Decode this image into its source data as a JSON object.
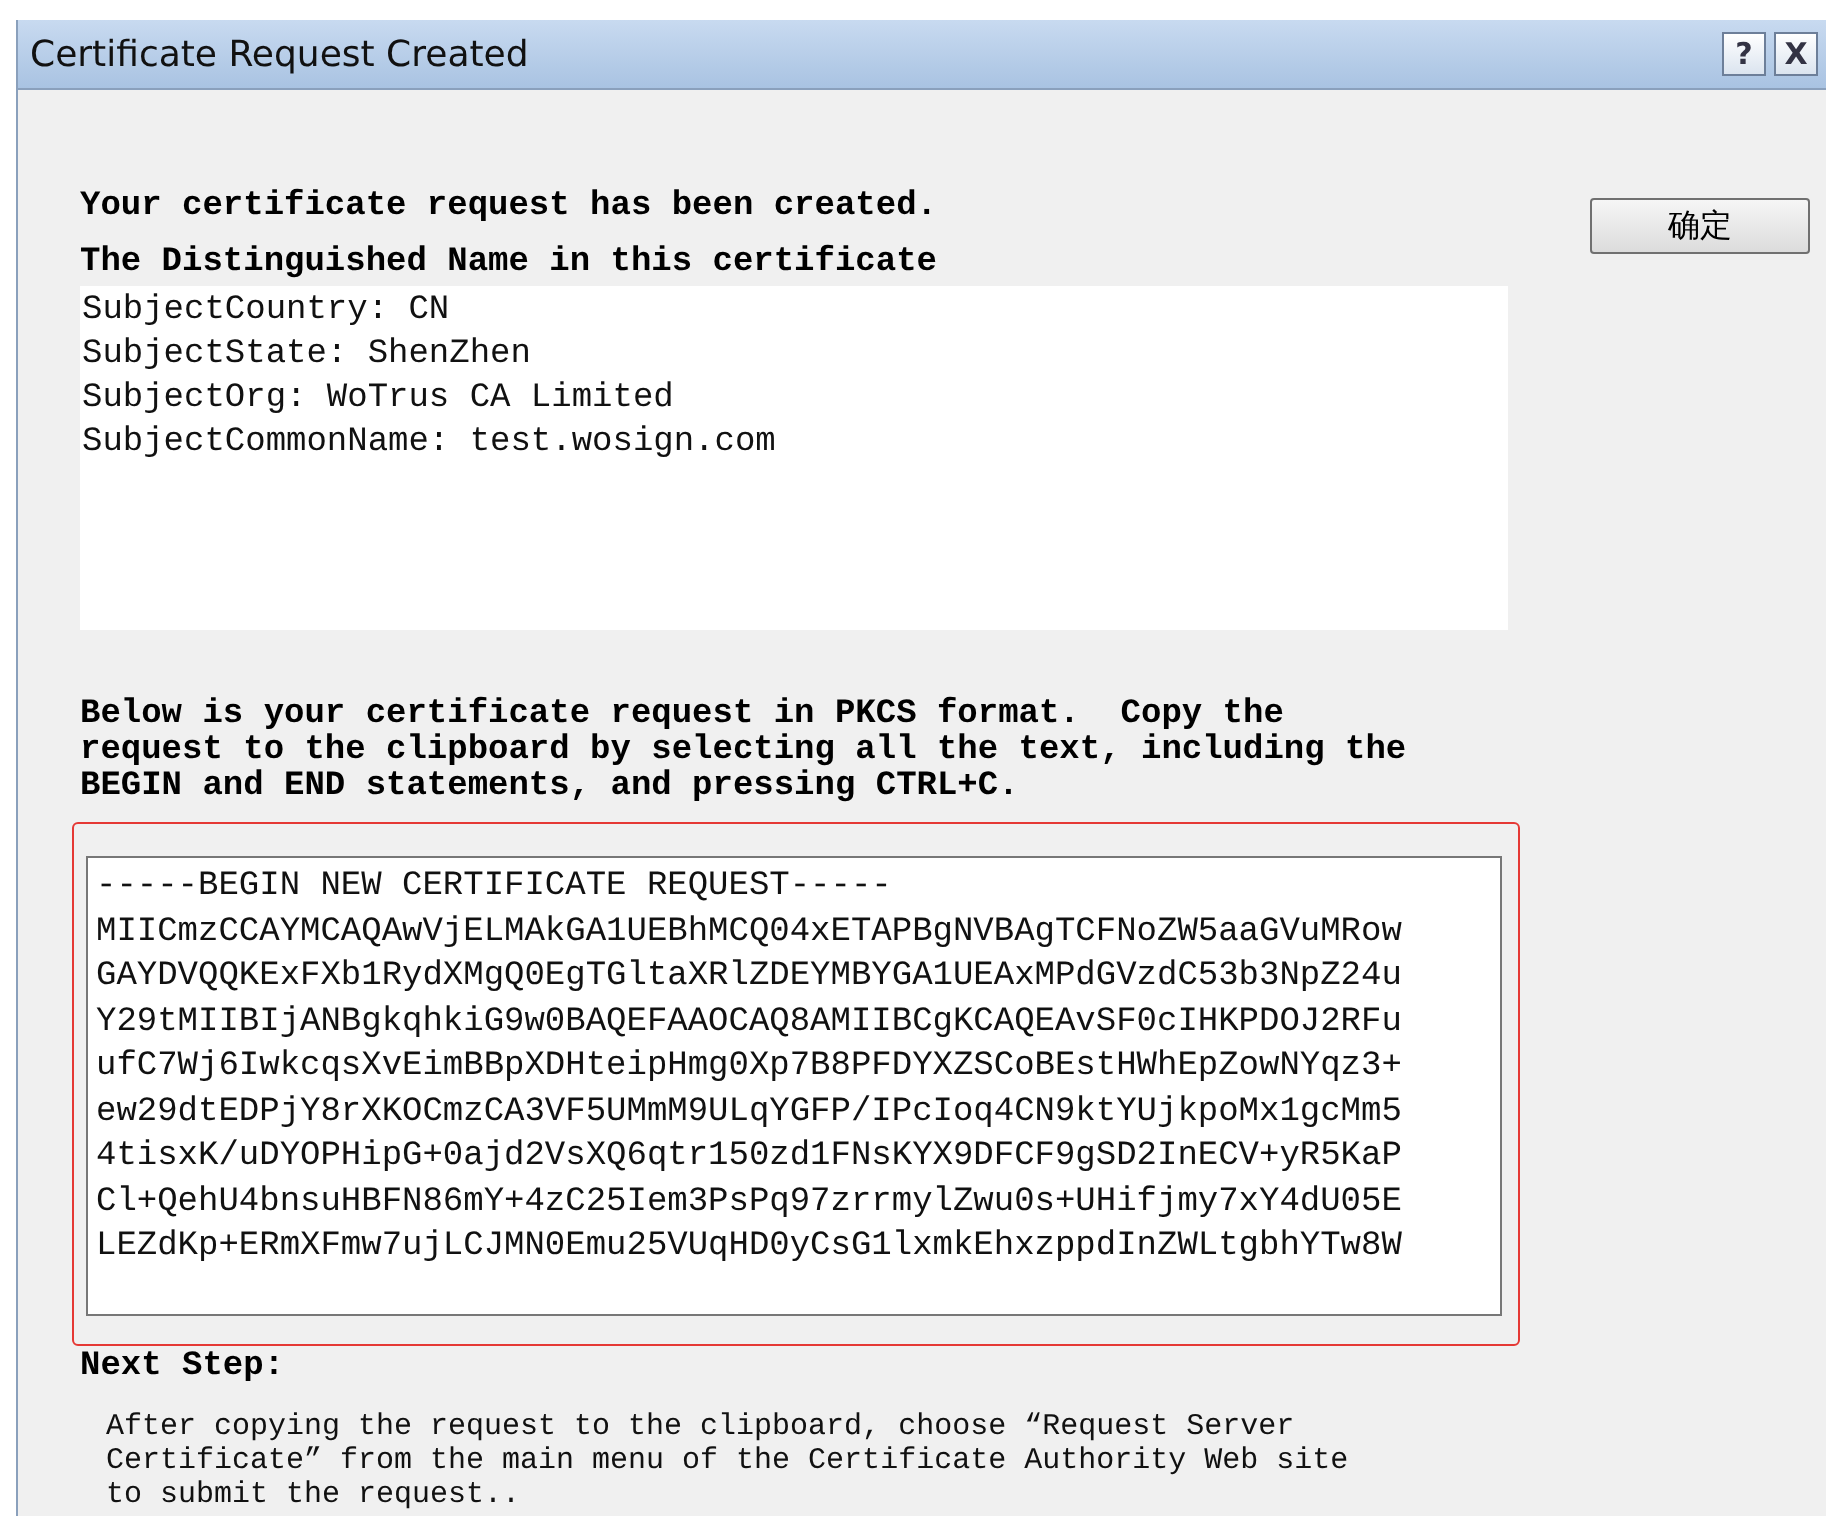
{
  "window": {
    "title": "Certificate Request Created"
  },
  "title_buttons": [
    "?",
    "X"
  ],
  "ok_button": {
    "label": "确定"
  },
  "intro": "Your certificate request has been created.",
  "dn_heading": "The Distinguished Name in this certificate",
  "dn_lines": [
    "SubjectCountry: CN",
    "SubjectState: ShenZhen",
    "SubjectOrg: WoTrus CA Limited",
    "SubjectCommonName: test.wosign.com"
  ],
  "pkcs_instructions": "Below is your certificate request in PKCS format.  Copy the request to the clipboard by selecting all the text, including the BEGIN and END statements, and pressing CTRL+C.",
  "request_lines": [
    "-----BEGIN NEW CERTIFICATE REQUEST-----",
    "MIICmzCCAYMCAQAwVjELMAkGA1UEBhMCQ04xETAPBgNVBAgTCFNoZW5aaGVuMRow",
    "GAYDVQQKExFXb1RydXMgQ0EgTGltaXRlZDEYMBYGA1UEAxMPdGVzdC53b3NpZ24u",
    "Y29tMIIBIjANBgkqhkiG9w0BAQEFAAOCAQ8AMIIBCgKCAQEAvSF0cIHKPDOJ2RFu",
    "ufC7Wj6IwkcqsXvEimBBpXDHteipHmg0Xp7B8PFDYXZSCoBEstHWhEpZowNYqz3+",
    "ew29dtEDPjY8rXKOCmzCA3VF5UMmM9ULqYGFP/IPcIoq4CN9ktYUjkpoMx1gcMm5",
    "4tisxK/uDYOPHipG+0ajd2VsXQ6qtr150zd1FNsKYX9DFCF9gSD2InECV+yR5KaP",
    "Cl+QehU4bnsuHBFN86mY+4zC25Iem3PsPq97zrrmylZwu0s+UHifjmy7xY4dU05E",
    "LEZdKp+ERmXFmw7ujLCJMN0Emu25VUqHD0yCsG1lxmkEhxzppdInZWLtgbhYTw8W"
  ],
  "next_step": {
    "heading": "Next Step:",
    "text": "After copying the request to the clipboard, choose “Request Server Certificate” from the main menu of the Certificate Authority Web site to submit the request.."
  }
}
